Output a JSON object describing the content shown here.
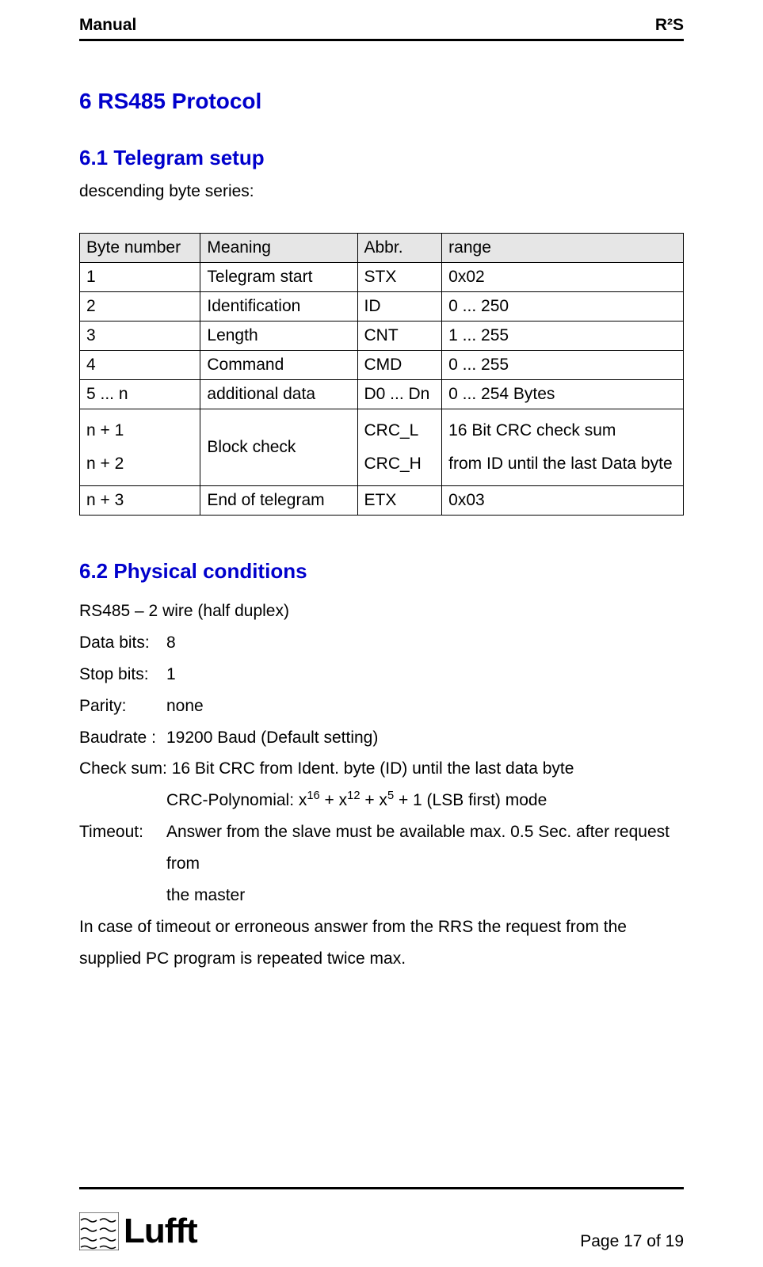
{
  "header": {
    "left": "Manual",
    "right": "R²S"
  },
  "h1": "6  RS485 Protocol",
  "section61": {
    "heading": "6.1  Telegram setup",
    "intro": "descending byte series:",
    "table": {
      "headers": [
        "Byte number",
        "Meaning",
        "Abbr.",
        "range"
      ],
      "rows": [
        [
          "1",
          "Telegram start",
          "STX",
          "0x02"
        ],
        [
          "2",
          "Identification",
          "ID",
          "0 ... 250"
        ],
        [
          "3",
          "Length",
          "CNT",
          "1 ... 255"
        ],
        [
          "4",
          "Command",
          "CMD",
          "0 ... 255"
        ],
        [
          "5 ... n",
          "additional data",
          "D0 ... Dn",
          "0 ... 254 Bytes"
        ]
      ],
      "multirow": {
        "col1a": "n + 1",
        "col1b": "n + 2",
        "col2": "Block check",
        "col3a": "CRC_L",
        "col3b": "CRC_H",
        "col4a": "16 Bit CRC check sum",
        "col4b": "from ID until the last Data byte"
      },
      "lastrow": [
        "n + 3",
        "End of telegram",
        "ETX",
        "0x03"
      ]
    }
  },
  "section62": {
    "heading": "6.2  Physical conditions",
    "line1": "RS485 – 2 wire  (half duplex)",
    "databits_label": "Data bits:",
    "databits_value": "8",
    "stopbits_label": "Stop bits:",
    "stopbits_value": "1",
    "parity_label": "Parity:",
    "parity_value": "none",
    "baudrate_label": "Baudrate :",
    "baudrate_value": "19200 Baud (Default setting)",
    "checksum_label": "Check sum:  16 Bit CRC from Ident. byte (ID) until the last data byte",
    "crc_poly_prefix": "CRC-Polynomial: x",
    "crc_poly_mid1": " + x",
    "crc_poly_mid2": " + x",
    "crc_poly_suffix": " + 1 (LSB first) mode",
    "sup16": "16",
    "sup12": "12",
    "sup5": "5",
    "timeout_label": "Timeout:",
    "timeout_value1": "Answer from the slave must be available max. 0.5 Sec. after request from",
    "timeout_value2": "the master",
    "closing": "In case of timeout or erroneous answer from the RRS the request from the supplied PC program is repeated twice max."
  },
  "footer": {
    "logo_text": "Lufft",
    "page": "Page 17 of 19"
  }
}
